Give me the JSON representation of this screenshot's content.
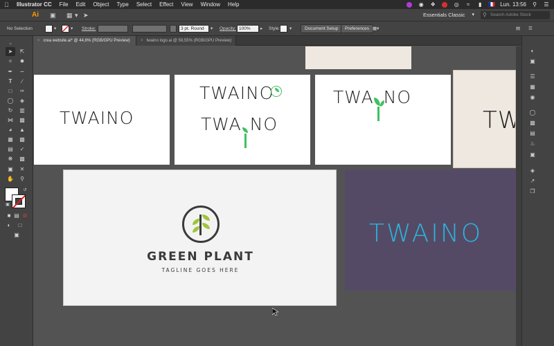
{
  "menubar": {
    "app_name": "Illustrator CC",
    "items": [
      "File",
      "Edit",
      "Object",
      "Type",
      "Select",
      "Effect",
      "View",
      "Window",
      "Help"
    ],
    "clock": "Lun. 13:56",
    "language": "🇫🇷"
  },
  "appbar": {
    "logo": "Ai",
    "workspace": "Essentials Classic",
    "search_placeholder": "Search Adobe Stock"
  },
  "control": {
    "selection": "No Selection",
    "stroke_label": "Stroke:",
    "stroke_profile": "3 pt. Round",
    "opacity_label": "Opacity:",
    "opacity_value": "100%",
    "style_label": "Style:",
    "document_setup": "Document Setup",
    "preferences": "Preferences"
  },
  "tabs": [
    {
      "label": "crea website.ai* @ 44,6% (RGB/GPU Preview)",
      "active": true
    },
    {
      "label": "twaino logo.ai @ 59,55% (RGB/GPU Preview)",
      "active": false
    }
  ],
  "artboards": {
    "wordmark": "TWAINO",
    "wordmark_split": [
      "TWA",
      "NO"
    ],
    "green_plant_title": "GREEN PLANT",
    "green_plant_tagline": "TAGLINE GOES HERE",
    "colors": {
      "accent_green": "#3fc060",
      "purple_bg": "#554a66",
      "cyan_text": "#2bb4dc",
      "beige_bg": "#efe8e0"
    }
  }
}
